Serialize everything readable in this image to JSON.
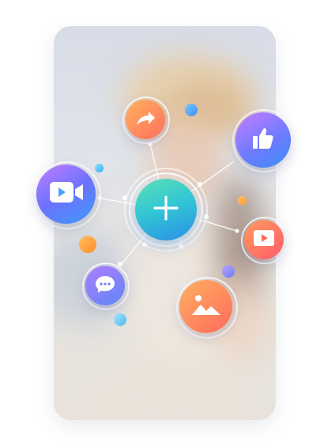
{
  "colors": {
    "accent_teal": "#33c7d3",
    "accent_blue": "#3b82f6",
    "accent_purple": "#9b6cf0",
    "accent_orange": "#ff8a4c",
    "accent_red": "#ff5f6d"
  },
  "actions": {
    "add": {
      "icon": "plus-icon"
    },
    "share": {
      "icon": "share-arrow-icon"
    },
    "like": {
      "icon": "thumbs-up-icon"
    },
    "video_call": {
      "icon": "video-camera-icon"
    },
    "play": {
      "icon": "play-icon"
    },
    "comment": {
      "icon": "chat-bubble-icon"
    },
    "photo": {
      "icon": "image-icon"
    }
  }
}
